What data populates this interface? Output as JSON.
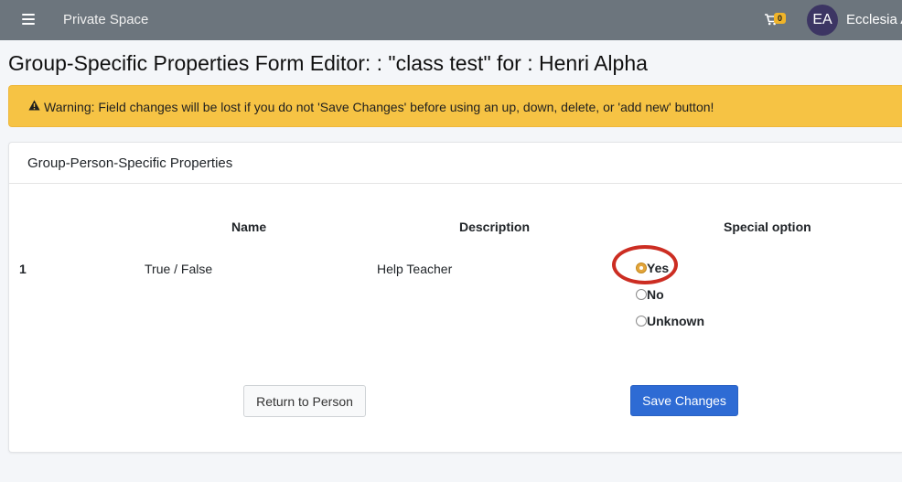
{
  "navbar": {
    "brand": "Private Space",
    "cart_count": "0",
    "avatar_initials": "EA",
    "user_name": "Ecclesia A"
  },
  "page": {
    "title": "Group-Specific Properties Form Editor: : \"class test\" for : Henri Alpha"
  },
  "alert": {
    "text": "Warning: Field changes will be lost if you do not 'Save Changes' before using an up, down, delete, or 'add new' button!"
  },
  "card": {
    "title": "Group-Person-Specific Properties",
    "columns": [
      "Name",
      "Description",
      "Special option"
    ],
    "rows": [
      {
        "index": "1",
        "name": "True / False",
        "description": "Help Teacher",
        "options": [
          "Yes",
          "No",
          "Unknown"
        ],
        "selected": "Yes"
      }
    ]
  },
  "buttons": {
    "return_label": "Return to Person",
    "save_label": "Save Changes"
  },
  "colors": {
    "navbar": "#6c757d",
    "warning": "#f6c344",
    "primary": "#2e6bd4",
    "highlight": "#cc2d22"
  }
}
